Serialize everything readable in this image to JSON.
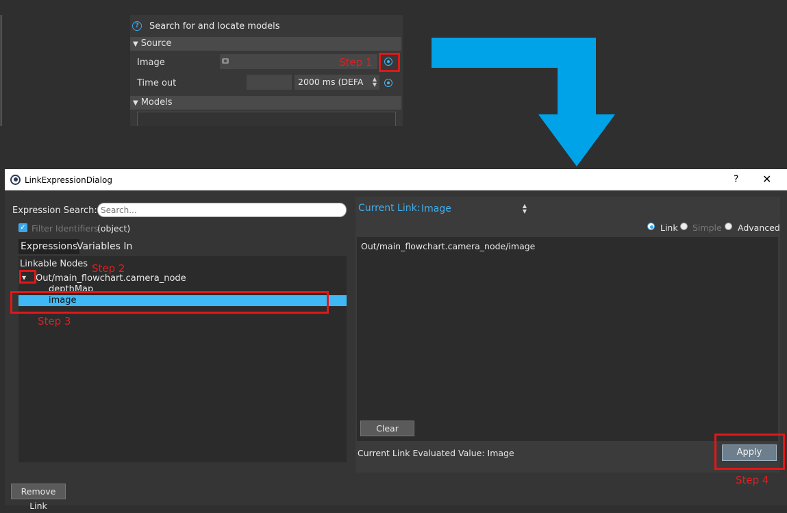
{
  "top_panel": {
    "title": "Search for and locate models",
    "source_section": "Source",
    "image_label": "Image",
    "timeout_label": "Time out",
    "timeout_value": "2000 ms (DEFA",
    "models_section": "Models",
    "help_icon": "?"
  },
  "annotations": {
    "step1": "Step 1",
    "step2": "Step 2",
    "step3": "Step 3",
    "step4": "Step 4",
    "accent_red": "#e01818",
    "arrow_color": "#00a2e8"
  },
  "dialog": {
    "title": "LinkExpressionDialog",
    "help_button": "?",
    "close_button": "✕",
    "expression_search_label": "Expression Search:",
    "search_placeholder": "Search...",
    "filter_identifiers_label": "Filter Identifiers",
    "filter_value": "(object)",
    "tabs": [
      "Expressions",
      "Variables In"
    ],
    "tree": {
      "header": "Linkable Nodes",
      "node": "Out/main_flowchart.camera_node",
      "children": [
        "depthMap",
        "image"
      ]
    },
    "current_link_label": "Current Link:",
    "current_link_value": "Image",
    "modes": [
      "Link",
      "Simple",
      "Advanced"
    ],
    "expression_text": "Out/main_flowchart.camera_node/image",
    "clear_button": "Clear",
    "evaluated_value_label": "Current Link Evaluated Value: Image",
    "apply_button": "Apply",
    "remove_link_button": "Remove Link",
    "selection_color": "#3fb8f5"
  }
}
